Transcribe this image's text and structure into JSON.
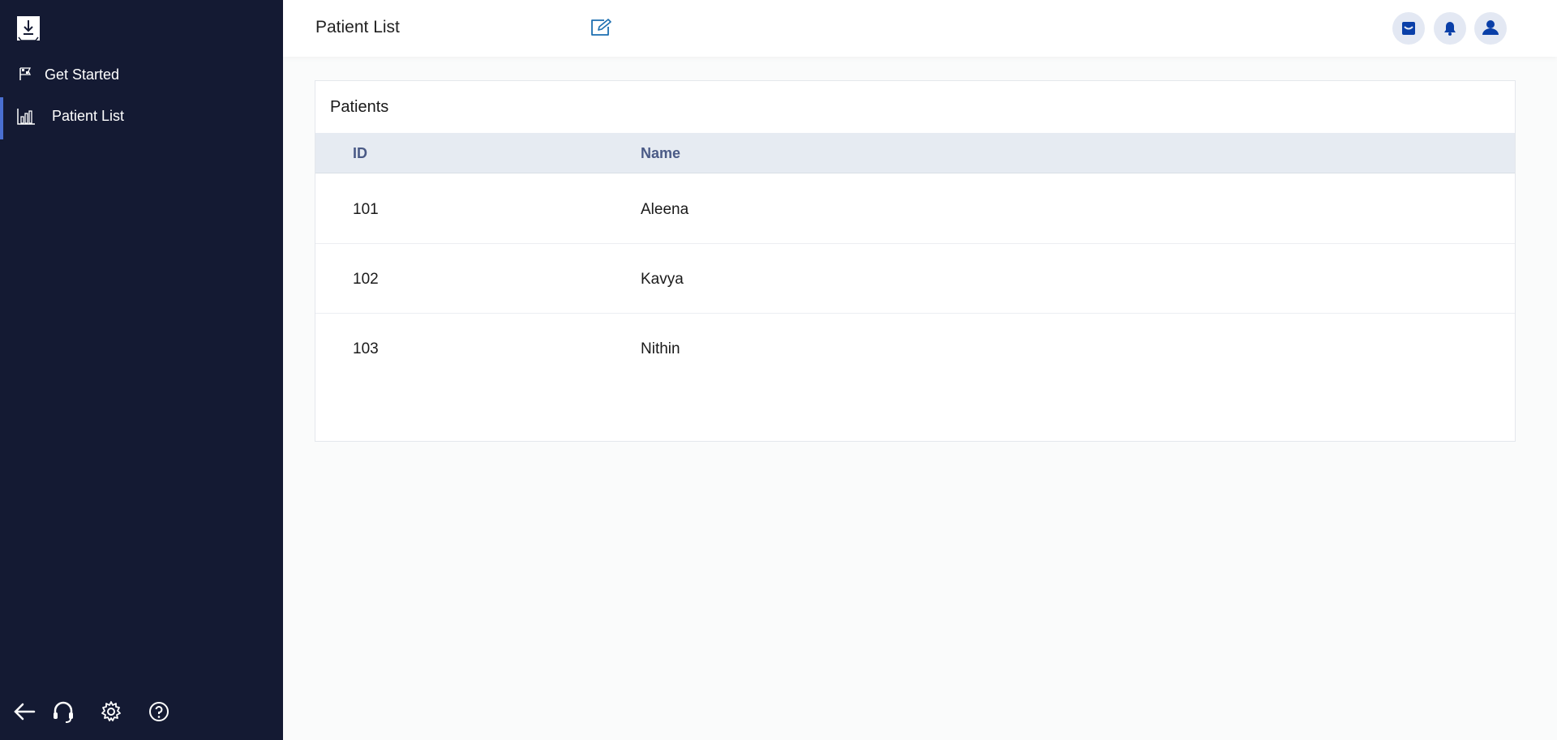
{
  "sidebar": {
    "items": [
      {
        "label": "Get Started",
        "icon": "checkered-flag-icon"
      },
      {
        "label": "Patient List",
        "icon": "bar-chart-icon",
        "active": true
      }
    ],
    "footer_icons": [
      "back-arrow-icon",
      "headset-icon",
      "gear-icon",
      "help-icon"
    ]
  },
  "header": {
    "title": "Patient List",
    "icons": [
      "edit-icon",
      "inbox-icon",
      "bell-icon",
      "user-icon"
    ]
  },
  "patients_card": {
    "title": "Patients",
    "columns": [
      "ID",
      "Name"
    ],
    "rows": [
      {
        "id": "101",
        "name": "Aleena"
      },
      {
        "id": "102",
        "name": "Kavya"
      },
      {
        "id": "103",
        "name": "Nithin"
      }
    ]
  },
  "colors": {
    "sidebar_bg": "#141a33",
    "accent": "#0a3fa8",
    "table_header_bg": "#e6ebf2"
  }
}
